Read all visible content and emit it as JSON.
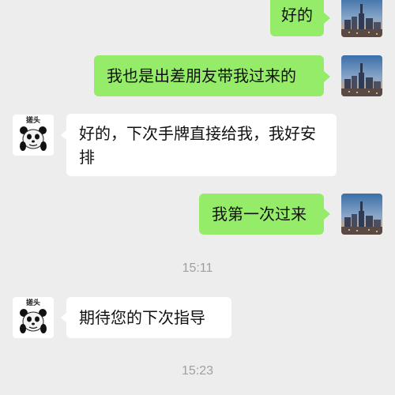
{
  "messages": [
    {
      "side": "right",
      "text": "好的"
    },
    {
      "side": "right",
      "text": "我也是出差朋友带我过来的"
    },
    {
      "side": "left",
      "text": "好的，下次手牌直接给我，我好安排"
    },
    {
      "side": "right",
      "text": "我第一次过来"
    },
    {
      "side": "left",
      "text": "期待您的下次指导"
    }
  ],
  "timestamps": [
    "15:11",
    "15:23"
  ],
  "avatars": {
    "self": "city-skyline-photo",
    "other": "panda-meme",
    "other_caption": "搓头"
  },
  "colors": {
    "background": "#ededed",
    "self_bubble": "#95ec69",
    "other_bubble": "#ffffff",
    "timestamp": "#a0a0a0"
  }
}
